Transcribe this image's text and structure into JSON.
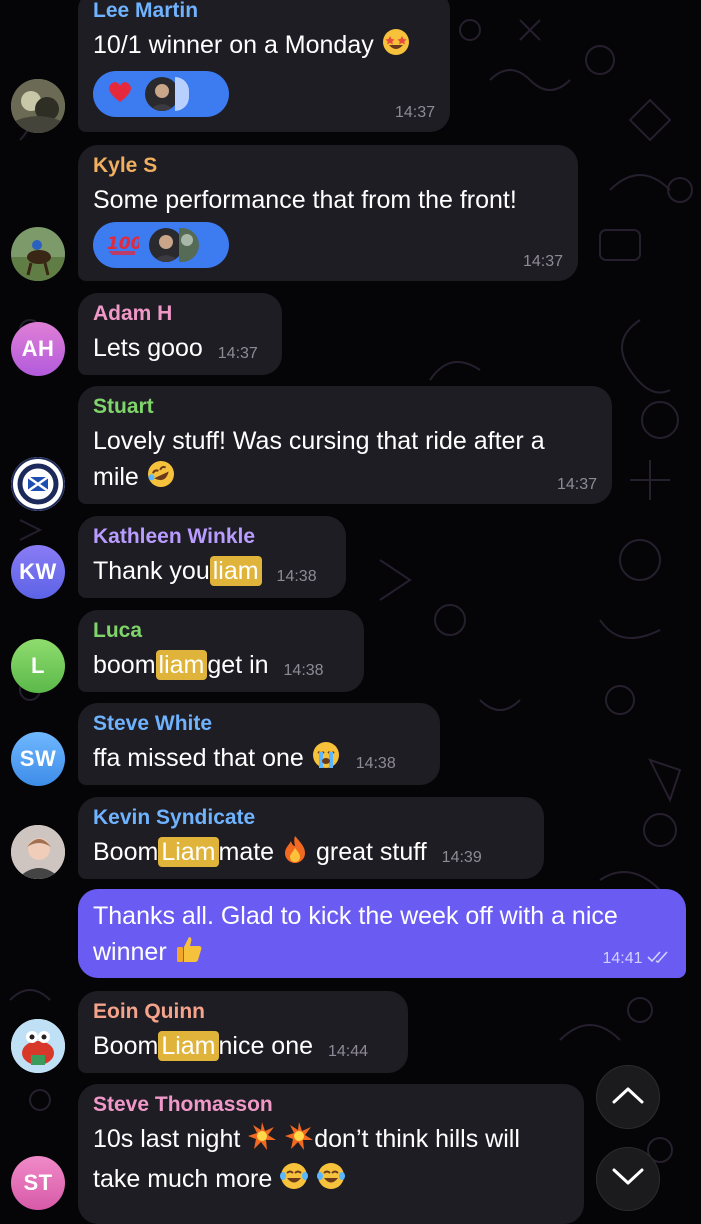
{
  "colors": {
    "background": "#050507",
    "incoming_bubble": "#1f1d24",
    "outgoing_bubble": "#6a5cf2",
    "mention_highlight": "#e0b43b",
    "reaction_pill": "#3d7bf0"
  },
  "messages": [
    {
      "sender": "Lee Martin",
      "text": "10/1 winner on a Monday",
      "emoji": "star-struck-emoji",
      "time": "14:37",
      "reaction": "red-heart",
      "sender_color": "#6fb3ff"
    },
    {
      "sender": "Kyle S",
      "text": "Some performance that from the front!",
      "time": "14:37",
      "reaction": "hundred-points",
      "sender_color": "#f0b060"
    },
    {
      "sender": "Adam H",
      "avatar_initials": "AH",
      "text": "Lets gooo",
      "time": "14:37",
      "sender_color": "#f099c9"
    },
    {
      "sender": "Stuart",
      "text_line1": "Lovely stuff! Was cursing that ride after a",
      "text_line2": "mile",
      "emoji": "rolling-on-floor-laughing-emoji",
      "time": "14:37",
      "sender_color": "#7fd46a"
    },
    {
      "sender": "Kathleen Winkle",
      "avatar_initials": "KW",
      "text_before": "Thank you",
      "mention": "liam",
      "time": "14:38",
      "sender_color": "#b89cff"
    },
    {
      "sender": "Luca",
      "avatar_initials": "L",
      "text_before": "boom",
      "mention": "liam",
      "text_after": "get in",
      "time": "14:38",
      "sender_color": "#7fd46a"
    },
    {
      "sender": "Steve White",
      "avatar_initials": "SW",
      "text": "ffa missed that one",
      "emoji": "loudly-crying-emoji",
      "time": "14:38",
      "sender_color": "#6fb3ff"
    },
    {
      "sender": "Kevin Syndicate",
      "text_before": "Boom",
      "mention": "Liam",
      "text_after": "mate",
      "emoji": "fire-emoji",
      "text_after2": "great stuff",
      "time": "14:39",
      "sender_color": "#6fb3ff"
    },
    {
      "outgoing": true,
      "text_line1": "Thanks all. Glad to kick the week off with a nice",
      "text_line2": "winner",
      "emoji": "thumbs-up-emoji",
      "time": "14:41"
    },
    {
      "sender": "Eoin Quinn",
      "text_before": "Boom",
      "mention": "Liam",
      "text_after": "nice one",
      "time": "14:44",
      "sender_color": "#f5a38a"
    },
    {
      "sender": "Steve Thomasson",
      "avatar_initials": "ST",
      "text_line1_a": "10s last night",
      "text_line1_b": "don’t think hills will",
      "text_line2": "take much more",
      "sender_color": "#f099c9"
    }
  ],
  "scroll_buttons": {
    "up_icon": "chevron-up-icon",
    "down_icon": "chevron-down-icon"
  }
}
